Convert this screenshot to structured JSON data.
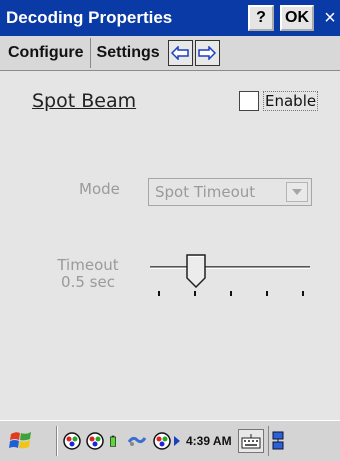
{
  "window": {
    "title": "Decoding Properties",
    "help_label": "?",
    "ok_label": "OK",
    "close_label": "×"
  },
  "menu": {
    "configure_label": "Configure",
    "settings_label": "Settings",
    "left_arrow_icon": "left-arrow-icon",
    "right_arrow_icon": "right-arrow-icon"
  },
  "section": {
    "title": "Spot Beam",
    "enable_label": "Enable",
    "enable_checked": false
  },
  "mode": {
    "label": "Mode",
    "selected": "Spot Timeout"
  },
  "timeout": {
    "label": "Timeout",
    "value_text": "0.5 sec",
    "tick_count": 5,
    "slider_position": 0.25
  },
  "taskbar": {
    "time": "4:39 AM",
    "icons": [
      "start-icon",
      "tray-app-icon",
      "tray-app-icon",
      "battery-icon",
      "connectivity-icon",
      "tray-app-icon",
      "keyboard-icon",
      "network-icon"
    ]
  },
  "colors": {
    "title_bar": "#0a3aa6",
    "background": "#e5e5e5",
    "disabled_text": "#9a9a9a"
  }
}
